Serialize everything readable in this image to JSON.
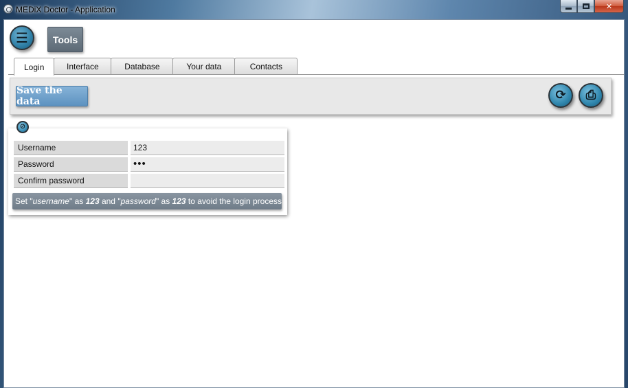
{
  "window": {
    "title": "MEDiX Doctor - Application",
    "icon": "medix-app-icon",
    "controls": {
      "minimize": "minimize",
      "maximize": "maximize",
      "close": "✕"
    }
  },
  "header": {
    "menu_icon": "hamburger-menu-icon",
    "tools_label": "Tools"
  },
  "tabs": [
    {
      "label": "Login",
      "active": true
    },
    {
      "label": "Interface",
      "active": false
    },
    {
      "label": "Database",
      "active": false
    },
    {
      "label": "Your data",
      "active": false
    },
    {
      "label": "Contacts",
      "active": false
    }
  ],
  "toolbar": {
    "save_label": "Save the data",
    "refresh_icon": "refresh-icon",
    "print_icon": "print-icon"
  },
  "login": {
    "panel_icon": "info-icon",
    "fields": {
      "username": {
        "label": "Username",
        "value": "123"
      },
      "password": {
        "label": "Password",
        "value": "•••"
      },
      "confirm": {
        "label": "Confirm password",
        "value": ""
      }
    },
    "hint": {
      "p1": "Set \"",
      "username_word": "username",
      "p2": "\" as ",
      "value1": "123",
      "p3": " and \"",
      "password_word": "password",
      "p4": "\" as ",
      "value2": "123",
      "p5": " to avoid the login process"
    }
  },
  "colors": {
    "save_button": "#6a9ecb",
    "tools_button": "#6b7884",
    "round_buttons": "#2f86ad"
  }
}
